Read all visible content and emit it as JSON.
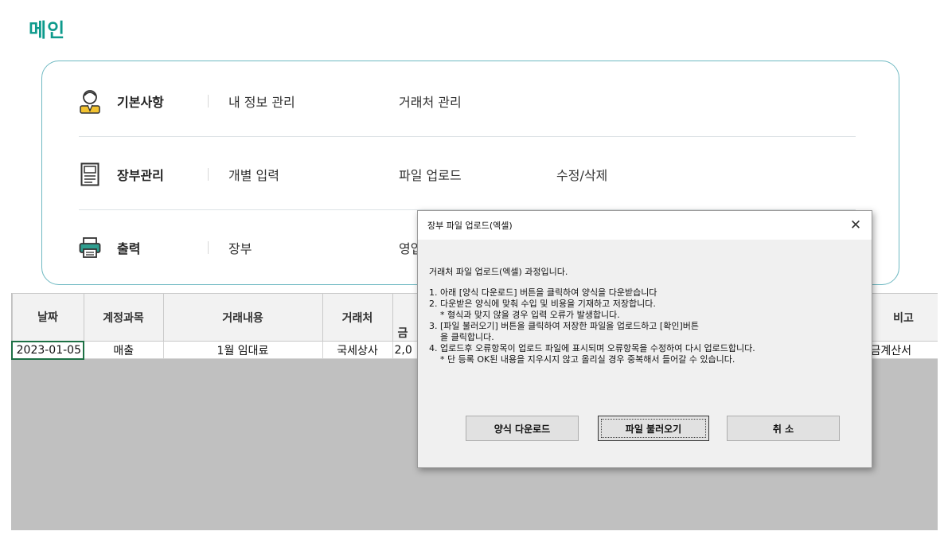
{
  "page": {
    "title": "메인"
  },
  "menu": {
    "rows": [
      {
        "icon": "person-icon",
        "label": "기본사항",
        "links": [
          "내 정보 관리",
          "거래처 관리"
        ]
      },
      {
        "icon": "ledger-icon",
        "label": "장부관리",
        "links": [
          "개별 입력",
          "파일 업로드",
          "수정/삭제"
        ]
      },
      {
        "icon": "printer-icon",
        "label": "출력",
        "links": [
          "장부",
          "영업"
        ]
      }
    ]
  },
  "sheet": {
    "headers": [
      "날짜",
      "계정과목",
      "거래내용",
      "거래처",
      "금",
      "비고"
    ],
    "rows": [
      {
        "date": "2023-01-05",
        "account": "매출",
        "content": "1월 임대료",
        "partner": "국세상사",
        "amount": "2,0",
        "remark": "금계산서"
      }
    ]
  },
  "dialog": {
    "title": "장부 파일 업로드(엑셀)",
    "intro": "거래처 파일 업로드(엑셀) 과정입니다.",
    "steps": [
      "1. 아래 [양식 다운로드] 버튼을 클릭하여 양식을 다운받습니다",
      "2. 다운받은 양식에 맞춰 수입 및 비용을 기재하고 저장합니다.",
      "    * 형식과 맞지 않을 경우 입력 오류가 발생합니다.",
      "3. [파일 불러오기] 버튼을 클릭하여 저장한 파일을 업로드하고 [확인]버튼",
      "    을 클릭합니다.",
      "4. 업로드후 오류항목이 업로드 파일에 표시되며 오류항목을 수정하여 다시 업로드합니다.",
      "    * 단 등록 OK된 내용을 지우시지 않고 올리실 경우 중복해서 들어갈 수 있습니다."
    ],
    "buttons": {
      "download": "양식 다운로드",
      "load": "파일 불러오기",
      "cancel": "취  소"
    },
    "close_glyph": "✕"
  },
  "colors": {
    "accent": "#0d9a8c",
    "panel_border": "#6fb9c2",
    "sheet_bg": "#c0c0c0",
    "cell_selected": "#1e7145",
    "icon_yellow": "#f2c230"
  }
}
